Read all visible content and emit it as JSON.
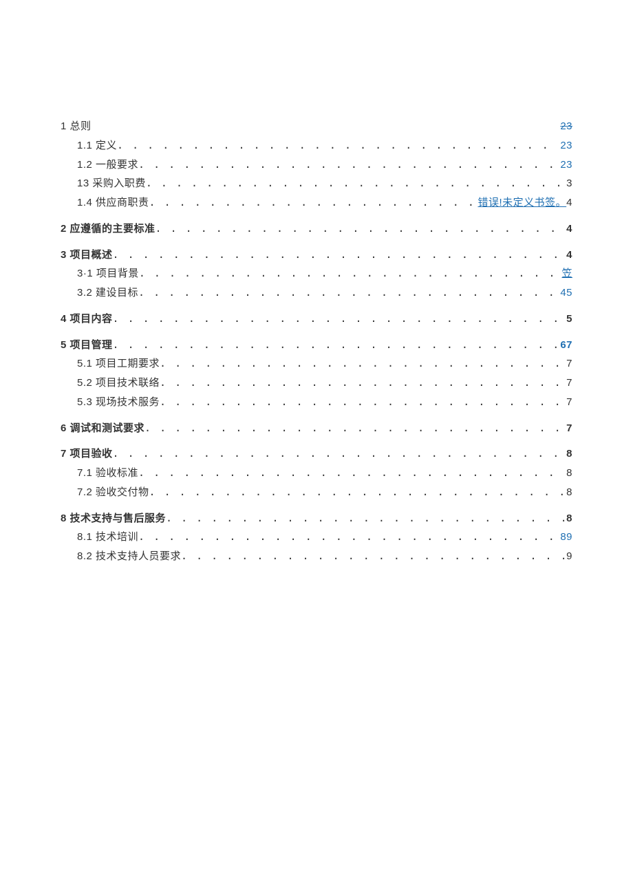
{
  "toc": {
    "s1": {
      "label": "1 总则",
      "page": "23"
    },
    "s1_1": {
      "label": "1.1   定义",
      "page": "23"
    },
    "s1_2": {
      "label": "1.2   一般要求",
      "page": "23"
    },
    "s1_3": {
      "label": "13 采购入职费",
      "page": "3"
    },
    "s1_4": {
      "label": "1.4   供应商职责",
      "error": "错误!未定义书签。",
      "page": "4"
    },
    "s2": {
      "label": "2 应遵循的主要标准",
      "page": "4"
    },
    "s3": {
      "label": "3 项目概述",
      "page": "4"
    },
    "s3_1": {
      "label": "3·1 项目背景",
      "page": "笠"
    },
    "s3_2": {
      "label": "3.2 建设目标",
      "page": "45"
    },
    "s4": {
      "label": "4 项目内容",
      "page": "5"
    },
    "s5": {
      "label": "5 项目管理",
      "page": "67"
    },
    "s5_1": {
      "label": "5.1 项目工期要求",
      "page": "7"
    },
    "s5_2": {
      "label": "5.2    项目技术联络",
      "page": "7"
    },
    "s5_3": {
      "label": "5.3    现场技术服务",
      "page": "7"
    },
    "s6": {
      "label": "6 调试和测试要求",
      "page": "7"
    },
    "s7": {
      "label": "7 项目验收",
      "page": "8"
    },
    "s7_1": {
      "label": "7.1 验收标准",
      "page": "8"
    },
    "s7_2": {
      "label": "7.2 验收交付物",
      "page": "8"
    },
    "s8": {
      "label": "8 技术支持与售后服务",
      "page": "8"
    },
    "s8_1": {
      "label": "8.1 技术培训",
      "page": "89"
    },
    "s8_2": {
      "label": "8.2 技术支持人员要求",
      "page": "9"
    }
  }
}
